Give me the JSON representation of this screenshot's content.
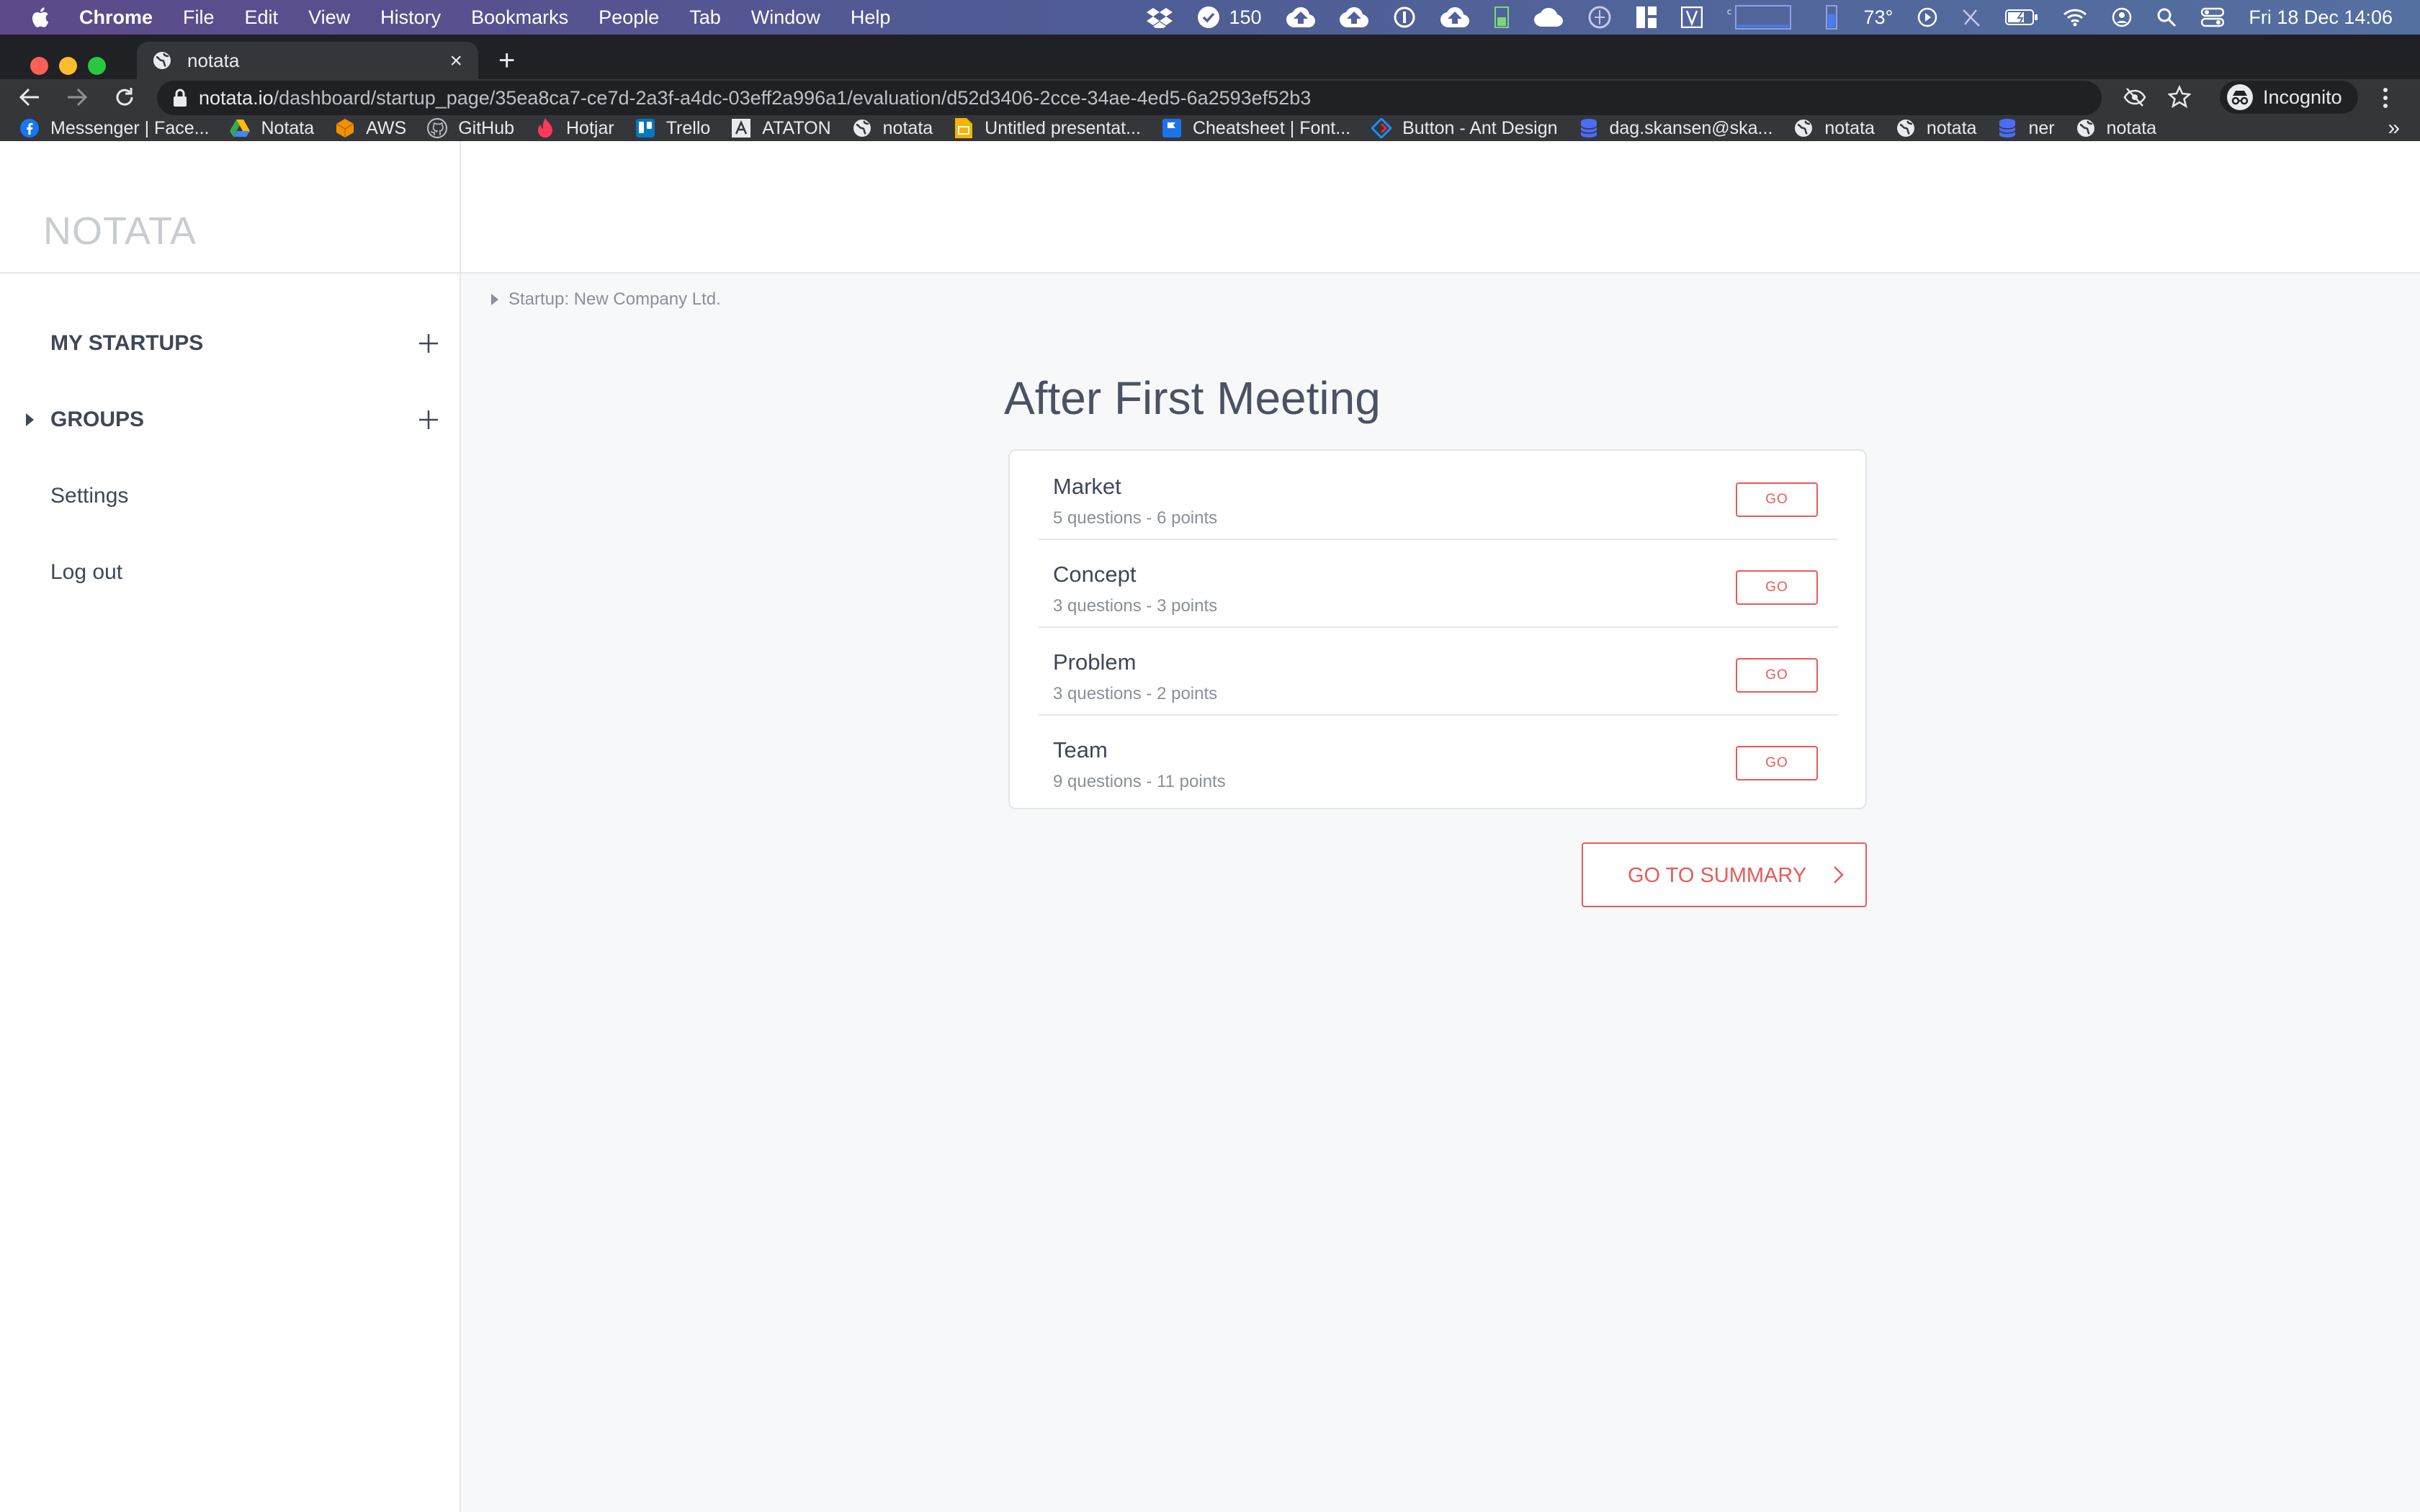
{
  "menubar": {
    "app": "Chrome",
    "items": [
      "File",
      "Edit",
      "View",
      "History",
      "Bookmarks",
      "People",
      "Tab",
      "Window",
      "Help"
    ],
    "status": {
      "dropbox_count": "150",
      "temperature": "73°",
      "datetime": "Fri 18 Dec  14:06"
    }
  },
  "browser": {
    "tab_title": "notata",
    "url_host": "notata.io",
    "url_path": "/dashboard/startup_page/35ea8ca7-ce7d-2a3f-a4dc-03eff2a996a1/evaluation/d52d3406-2cce-34ae-4ed5-6a2593ef52b3",
    "profile_label": "Incognito",
    "bookmarks": [
      {
        "label": "Messenger | Face...",
        "icon": "facebook-icon",
        "color": "#1877f2"
      },
      {
        "label": "Notata",
        "icon": "google-drive-icon",
        "color": "#34a853"
      },
      {
        "label": "AWS",
        "icon": "aws-cube-icon",
        "color": "#f29100"
      },
      {
        "label": "GitHub",
        "icon": "github-icon",
        "color": "#bdc1c6"
      },
      {
        "label": "Hotjar",
        "icon": "hotjar-icon",
        "color": "#fd3a5c"
      },
      {
        "label": "Trello",
        "icon": "trello-icon",
        "color": "#0079bf"
      },
      {
        "label": "ATATON",
        "icon": "ataton-icon",
        "color": "#e8eaed"
      },
      {
        "label": "notata",
        "icon": "globe-icon",
        "color": "#e8eaed"
      },
      {
        "label": "Untitled presentat...",
        "icon": "slides-icon",
        "color": "#f4b400"
      },
      {
        "label": "Cheatsheet | Font...",
        "icon": "flag-icon",
        "color": "#1a73e8"
      },
      {
        "label": "Button - Ant Design",
        "icon": "ant-design-icon",
        "color": "#1890ff"
      },
      {
        "label": "dag.skansen@ska...",
        "icon": "database-icon",
        "color": "#4a6cf7"
      },
      {
        "label": "notata",
        "icon": "globe-icon",
        "color": "#e8eaed"
      },
      {
        "label": "notata",
        "icon": "globe-icon",
        "color": "#e8eaed"
      },
      {
        "label": "ner",
        "icon": "database-icon",
        "color": "#4a6cf7"
      },
      {
        "label": "notata",
        "icon": "globe-icon",
        "color": "#e8eaed"
      }
    ]
  },
  "sidebar": {
    "logo": "NOTATA",
    "items": [
      {
        "label": "MY STARTUPS"
      },
      {
        "label": "GROUPS"
      },
      {
        "label": "Settings"
      },
      {
        "label": "Log out"
      }
    ]
  },
  "main": {
    "breadcrumb": "Startup: New Company Ltd.",
    "title": "After First Meeting",
    "sections": [
      {
        "name": "Market",
        "meta": "5 questions - 6 points",
        "button": "GO"
      },
      {
        "name": "Concept",
        "meta": "3 questions - 3 points",
        "button": "GO"
      },
      {
        "name": "Problem",
        "meta": "3 questions - 2 points",
        "button": "GO"
      },
      {
        "name": "Team",
        "meta": "9 questions - 11 points",
        "button": "GO"
      }
    ],
    "summary_button": "GO TO SUMMARY"
  },
  "colors": {
    "accent": "#e85a5a",
    "text": "#3f4757",
    "muted": "#8a8f99"
  }
}
